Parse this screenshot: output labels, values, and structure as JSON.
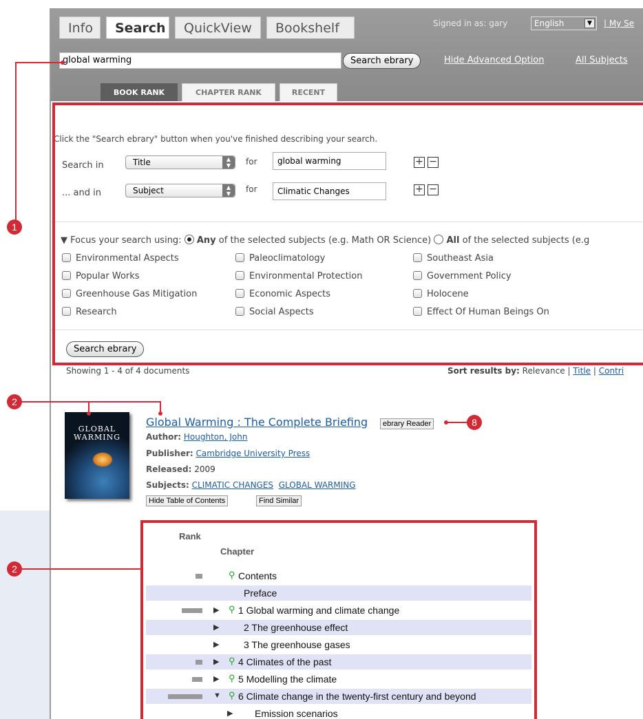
{
  "tabs": [
    {
      "label": "Info"
    },
    {
      "label": "Search"
    },
    {
      "label": "QuickView"
    },
    {
      "label": "Bookshelf"
    }
  ],
  "header": {
    "signed_in": "Signed in as: gary",
    "language": "English",
    "my_searches": "| My Se"
  },
  "search": {
    "query": "global warming",
    "button": "Search ebrary",
    "hide_advanced": "Hide Advanced Option",
    "all_subjects": "All Subjects"
  },
  "rank_tabs": [
    {
      "label": "BOOK RANK"
    },
    {
      "label": "CHAPTER RANK"
    },
    {
      "label": "RECENT"
    }
  ],
  "advanced": {
    "instruction": "Click the \"Search ebrary\" button when you've finished describing your search.",
    "rows": [
      {
        "label": "Search in",
        "field": "Title",
        "for": "for",
        "value": "global warming"
      },
      {
        "label": "... and in",
        "field": "Subject",
        "for": "for",
        "value": "Climatic Changes"
      }
    ],
    "focus_prefix": "▼ Focus your search using:",
    "any_bold": "Any",
    "any_rest": "of the selected subjects (e.g. Math OR Science)",
    "all_bold": "All",
    "all_rest": "of the selected subjects (e.g",
    "subjects": [
      "Environmental Aspects",
      "Paleoclimatology",
      "Southeast Asia",
      "Popular Works",
      "Environmental Protection",
      "Government Policy",
      "Greenhouse Gas Mitigation",
      "Economic Aspects",
      "Holocene",
      "Research",
      "Social Aspects",
      "Effect Of Human Beings On"
    ],
    "search_button": "Search ebrary"
  },
  "results": {
    "showing": "Showing 1 - 4 of 4 documents",
    "sort_label": "Sort results by:",
    "sort_relevance": "Relevance",
    "sort_sep1": "|",
    "sort_title": "Title",
    "sort_sep2": "|",
    "sort_contrib": "Contri"
  },
  "book": {
    "cover_line1": "GLOBAL",
    "cover_line2": "WARMING",
    "title": "Global Warming : The Complete Briefing",
    "reader_button": "ebrary Reader",
    "author_label": "Author:",
    "author": "Houghton, John",
    "publisher_label": "Publisher:",
    "publisher": "Cambridge University Press",
    "released_label": "Released:",
    "released": "2009",
    "subjects_label": "Subjects:",
    "subject1": "CLIMATIC CHANGES",
    "subject2": "GLOBAL WARMING",
    "hide_toc": "Hide Table of Contents",
    "find_similar": "Find Similar"
  },
  "toc": {
    "rank_header": "Rank",
    "chapter_header": "Chapter",
    "rows": [
      {
        "title": "Contents",
        "rank": 0.2,
        "arrow": "",
        "search": true,
        "hl": false
      },
      {
        "title": "Preface",
        "rank": 0,
        "arrow": "",
        "search": false,
        "hl": true
      },
      {
        "title": "1 Global warming and climate change",
        "rank": 0.6,
        "arrow": "▶",
        "search": true,
        "hl": false
      },
      {
        "title": "2 The greenhouse effect",
        "rank": 0,
        "arrow": "▶",
        "search": false,
        "hl": true
      },
      {
        "title": "3 The greenhouse gases",
        "rank": 0,
        "arrow": "▶",
        "search": false,
        "hl": false
      },
      {
        "title": "4 Climates of the past",
        "rank": 0.2,
        "arrow": "▶",
        "search": true,
        "hl": true
      },
      {
        "title": "5 Modelling the climate",
        "rank": 0.3,
        "arrow": "▶",
        "search": true,
        "hl": false
      },
      {
        "title": "6 Climate change in the twenty-first century and beyond",
        "rank": 1,
        "arrow": "▼",
        "search": true,
        "hl": true
      },
      {
        "title": "Emission scenarios",
        "rank": 0,
        "arrow": "▶",
        "search": false,
        "hl": false,
        "indent": true
      }
    ]
  },
  "callouts": [
    "1",
    "2",
    "2",
    "8"
  ]
}
